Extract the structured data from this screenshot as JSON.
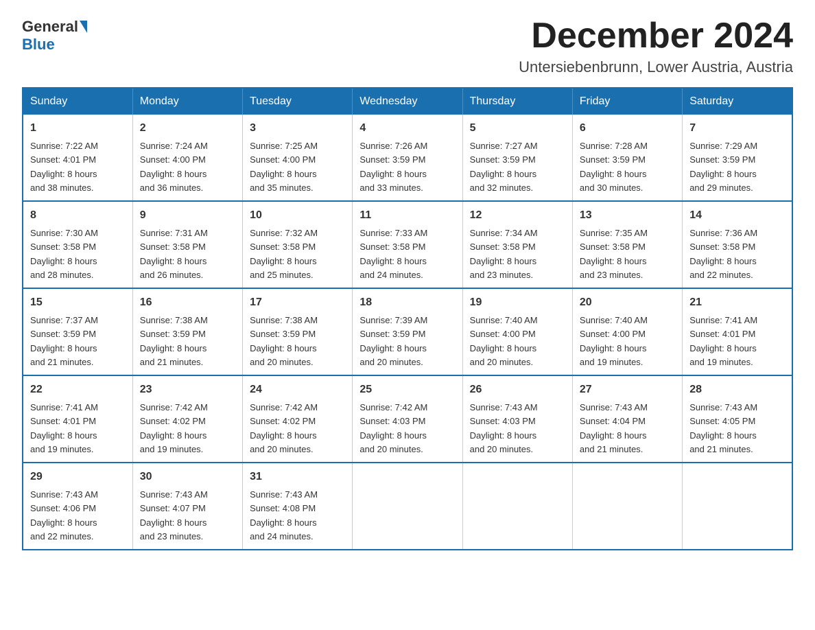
{
  "logo": {
    "text_general": "General",
    "text_blue": "Blue"
  },
  "title": "December 2024",
  "subtitle": "Untersiebenbrunn, Lower Austria, Austria",
  "weekdays": [
    "Sunday",
    "Monday",
    "Tuesday",
    "Wednesday",
    "Thursday",
    "Friday",
    "Saturday"
  ],
  "weeks": [
    [
      {
        "day": "1",
        "sunrise": "7:22 AM",
        "sunset": "4:01 PM",
        "daylight": "8 hours and 38 minutes."
      },
      {
        "day": "2",
        "sunrise": "7:24 AM",
        "sunset": "4:00 PM",
        "daylight": "8 hours and 36 minutes."
      },
      {
        "day": "3",
        "sunrise": "7:25 AM",
        "sunset": "4:00 PM",
        "daylight": "8 hours and 35 minutes."
      },
      {
        "day": "4",
        "sunrise": "7:26 AM",
        "sunset": "3:59 PM",
        "daylight": "8 hours and 33 minutes."
      },
      {
        "day": "5",
        "sunrise": "7:27 AM",
        "sunset": "3:59 PM",
        "daylight": "8 hours and 32 minutes."
      },
      {
        "day": "6",
        "sunrise": "7:28 AM",
        "sunset": "3:59 PM",
        "daylight": "8 hours and 30 minutes."
      },
      {
        "day": "7",
        "sunrise": "7:29 AM",
        "sunset": "3:59 PM",
        "daylight": "8 hours and 29 minutes."
      }
    ],
    [
      {
        "day": "8",
        "sunrise": "7:30 AM",
        "sunset": "3:58 PM",
        "daylight": "8 hours and 28 minutes."
      },
      {
        "day": "9",
        "sunrise": "7:31 AM",
        "sunset": "3:58 PM",
        "daylight": "8 hours and 26 minutes."
      },
      {
        "day": "10",
        "sunrise": "7:32 AM",
        "sunset": "3:58 PM",
        "daylight": "8 hours and 25 minutes."
      },
      {
        "day": "11",
        "sunrise": "7:33 AM",
        "sunset": "3:58 PM",
        "daylight": "8 hours and 24 minutes."
      },
      {
        "day": "12",
        "sunrise": "7:34 AM",
        "sunset": "3:58 PM",
        "daylight": "8 hours and 23 minutes."
      },
      {
        "day": "13",
        "sunrise": "7:35 AM",
        "sunset": "3:58 PM",
        "daylight": "8 hours and 23 minutes."
      },
      {
        "day": "14",
        "sunrise": "7:36 AM",
        "sunset": "3:58 PM",
        "daylight": "8 hours and 22 minutes."
      }
    ],
    [
      {
        "day": "15",
        "sunrise": "7:37 AM",
        "sunset": "3:59 PM",
        "daylight": "8 hours and 21 minutes."
      },
      {
        "day": "16",
        "sunrise": "7:38 AM",
        "sunset": "3:59 PM",
        "daylight": "8 hours and 21 minutes."
      },
      {
        "day": "17",
        "sunrise": "7:38 AM",
        "sunset": "3:59 PM",
        "daylight": "8 hours and 20 minutes."
      },
      {
        "day": "18",
        "sunrise": "7:39 AM",
        "sunset": "3:59 PM",
        "daylight": "8 hours and 20 minutes."
      },
      {
        "day": "19",
        "sunrise": "7:40 AM",
        "sunset": "4:00 PM",
        "daylight": "8 hours and 20 minutes."
      },
      {
        "day": "20",
        "sunrise": "7:40 AM",
        "sunset": "4:00 PM",
        "daylight": "8 hours and 19 minutes."
      },
      {
        "day": "21",
        "sunrise": "7:41 AM",
        "sunset": "4:01 PM",
        "daylight": "8 hours and 19 minutes."
      }
    ],
    [
      {
        "day": "22",
        "sunrise": "7:41 AM",
        "sunset": "4:01 PM",
        "daylight": "8 hours and 19 minutes."
      },
      {
        "day": "23",
        "sunrise": "7:42 AM",
        "sunset": "4:02 PM",
        "daylight": "8 hours and 19 minutes."
      },
      {
        "day": "24",
        "sunrise": "7:42 AM",
        "sunset": "4:02 PM",
        "daylight": "8 hours and 20 minutes."
      },
      {
        "day": "25",
        "sunrise": "7:42 AM",
        "sunset": "4:03 PM",
        "daylight": "8 hours and 20 minutes."
      },
      {
        "day": "26",
        "sunrise": "7:43 AM",
        "sunset": "4:03 PM",
        "daylight": "8 hours and 20 minutes."
      },
      {
        "day": "27",
        "sunrise": "7:43 AM",
        "sunset": "4:04 PM",
        "daylight": "8 hours and 21 minutes."
      },
      {
        "day": "28",
        "sunrise": "7:43 AM",
        "sunset": "4:05 PM",
        "daylight": "8 hours and 21 minutes."
      }
    ],
    [
      {
        "day": "29",
        "sunrise": "7:43 AM",
        "sunset": "4:06 PM",
        "daylight": "8 hours and 22 minutes."
      },
      {
        "day": "30",
        "sunrise": "7:43 AM",
        "sunset": "4:07 PM",
        "daylight": "8 hours and 23 minutes."
      },
      {
        "day": "31",
        "sunrise": "7:43 AM",
        "sunset": "4:08 PM",
        "daylight": "8 hours and 24 minutes."
      },
      null,
      null,
      null,
      null
    ]
  ],
  "labels": {
    "sunrise": "Sunrise:",
    "sunset": "Sunset:",
    "daylight": "Daylight:"
  }
}
